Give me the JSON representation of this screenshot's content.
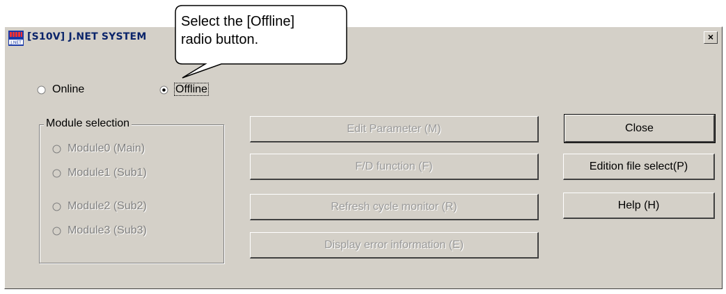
{
  "window": {
    "title": "[S10V] J.NET SYSTEM",
    "close_glyph": "×"
  },
  "callout": {
    "line1": "Select the [Offline]",
    "line2": "radio button."
  },
  "mode": {
    "online_label": "Online",
    "offline_label": "Offline",
    "selected": "Offline"
  },
  "module_selection": {
    "title": "Module selection",
    "options": [
      "Module0 (Main)",
      "Module1 (Sub1)",
      "Module2 (Sub2)",
      "Module3 (Sub3)"
    ]
  },
  "actions": {
    "edit_parameter": "Edit Parameter (M)",
    "fd_function": "F/D function (F)",
    "refresh_cycle_monitor": "Refresh cycle monitor (R)",
    "display_error_information": "Display error information (E)"
  },
  "side_buttons": {
    "close": "Close",
    "edition_file_select": "Edition file select(P)",
    "help": "Help (H)"
  },
  "colors": {
    "dialog_bg": "#d4d0c8",
    "title_text": "#0a246a",
    "disabled_text": "#808080"
  },
  "icons": {
    "app": "jnet-app-icon",
    "close": "close-icon",
    "radio_on": "radio-selected-icon",
    "radio_off": "radio-unselected-icon"
  }
}
